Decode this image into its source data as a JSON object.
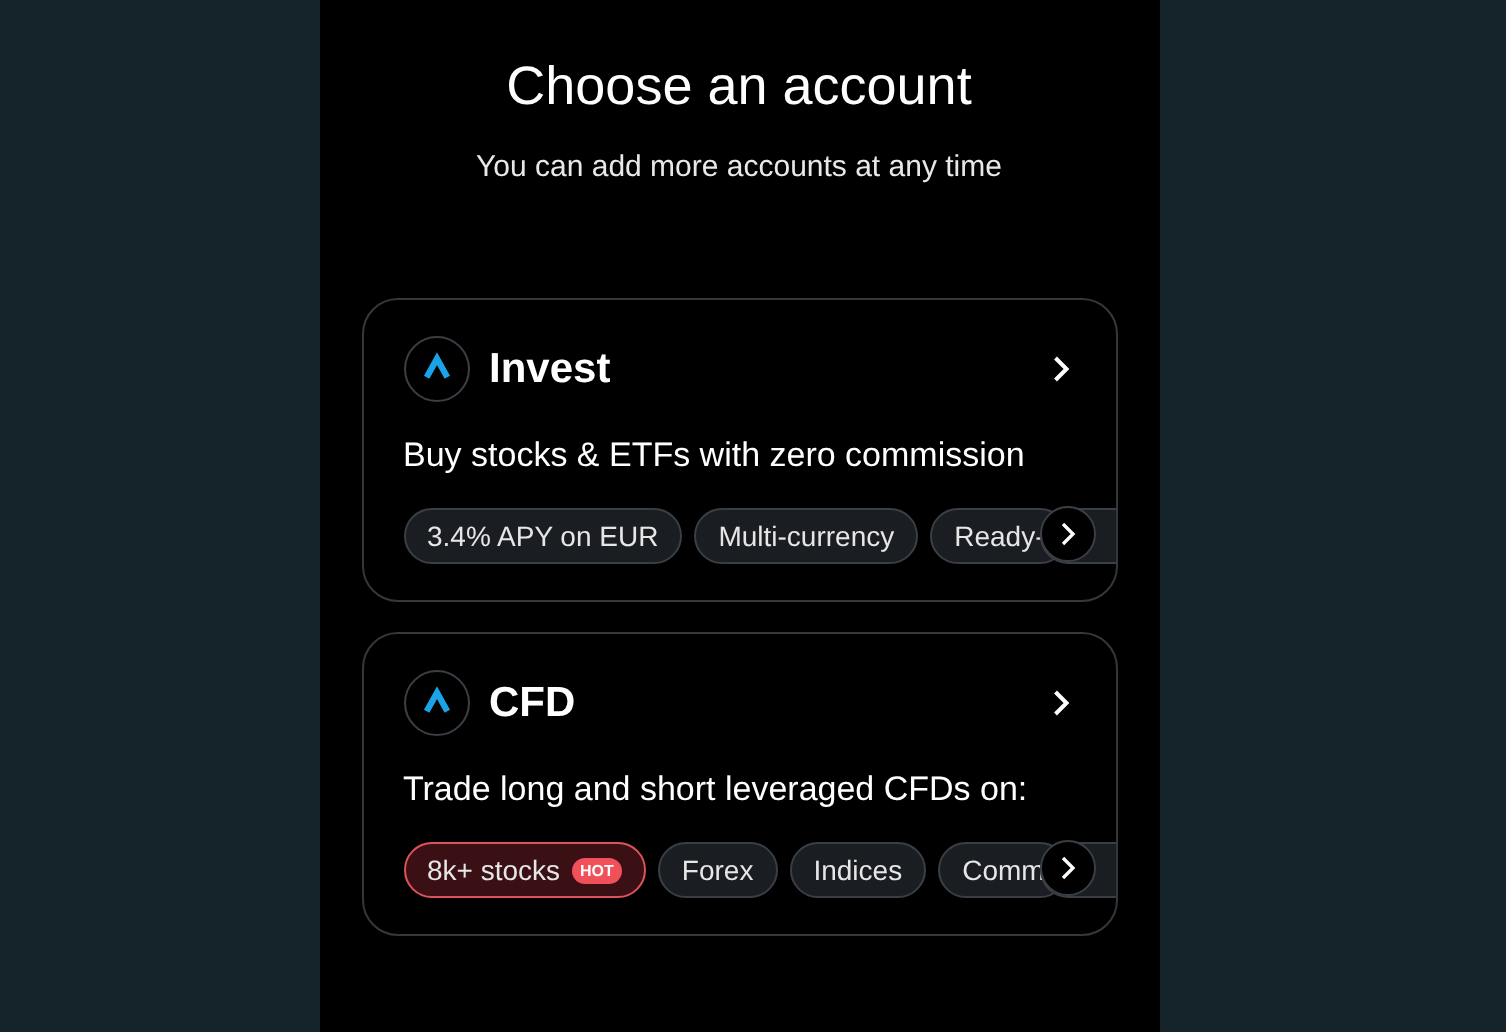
{
  "header": {
    "title": "Choose an account",
    "subtitle": "You can add more accounts at any time"
  },
  "accounts": [
    {
      "name": "Invest",
      "description": "Buy stocks & ETFs with zero commission",
      "tags": [
        {
          "label": "3.4% APY on EUR",
          "kind": "plain"
        },
        {
          "label": "Multi-currency",
          "kind": "plain"
        },
        {
          "label": "Ready-",
          "kind": "plain"
        }
      ]
    },
    {
      "name": "CFD",
      "description": "Trade long and short leveraged CFDs on:",
      "tags": [
        {
          "label": "8k+ stocks",
          "kind": "hot",
          "badge": "HOT"
        },
        {
          "label": "Forex",
          "kind": "plain"
        },
        {
          "label": "Indices",
          "kind": "plain"
        },
        {
          "label": "Comm",
          "kind": "plain"
        }
      ]
    }
  ]
}
